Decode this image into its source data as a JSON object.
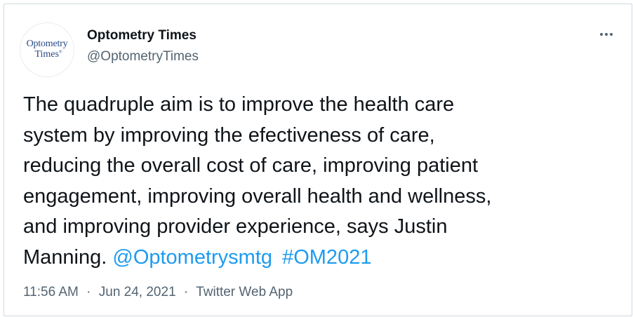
{
  "author": {
    "avatar_line1": "Optometry",
    "avatar_line2": "Times",
    "avatar_mark": "®",
    "display_name": "Optometry Times",
    "handle": "@OptometryTimes"
  },
  "menu": {
    "icon": "more-horizontal-icon"
  },
  "tweet": {
    "text_line1": "The quadruple aim is to improve the health care",
    "text_line2": "system by improving the efectiveness of care,",
    "text_line3": "reducing the overall cost of care, improving patient",
    "text_line4": "engagement, improving overall health and wellness,",
    "text_line5": "and improving provider experience, says Justin",
    "text_line6_start": "Manning.",
    "mention": "@Optometrysmtg",
    "hashtag": "#OM2021"
  },
  "meta": {
    "time": "11:56 AM",
    "separator": "·",
    "date": "Jun 24, 2021",
    "source": "Twitter Web App"
  },
  "colors": {
    "text": "#0f1419",
    "secondary": "#536471",
    "link": "#1d9bf0",
    "border": "#cfd9de",
    "brand": "#2a4a87"
  }
}
